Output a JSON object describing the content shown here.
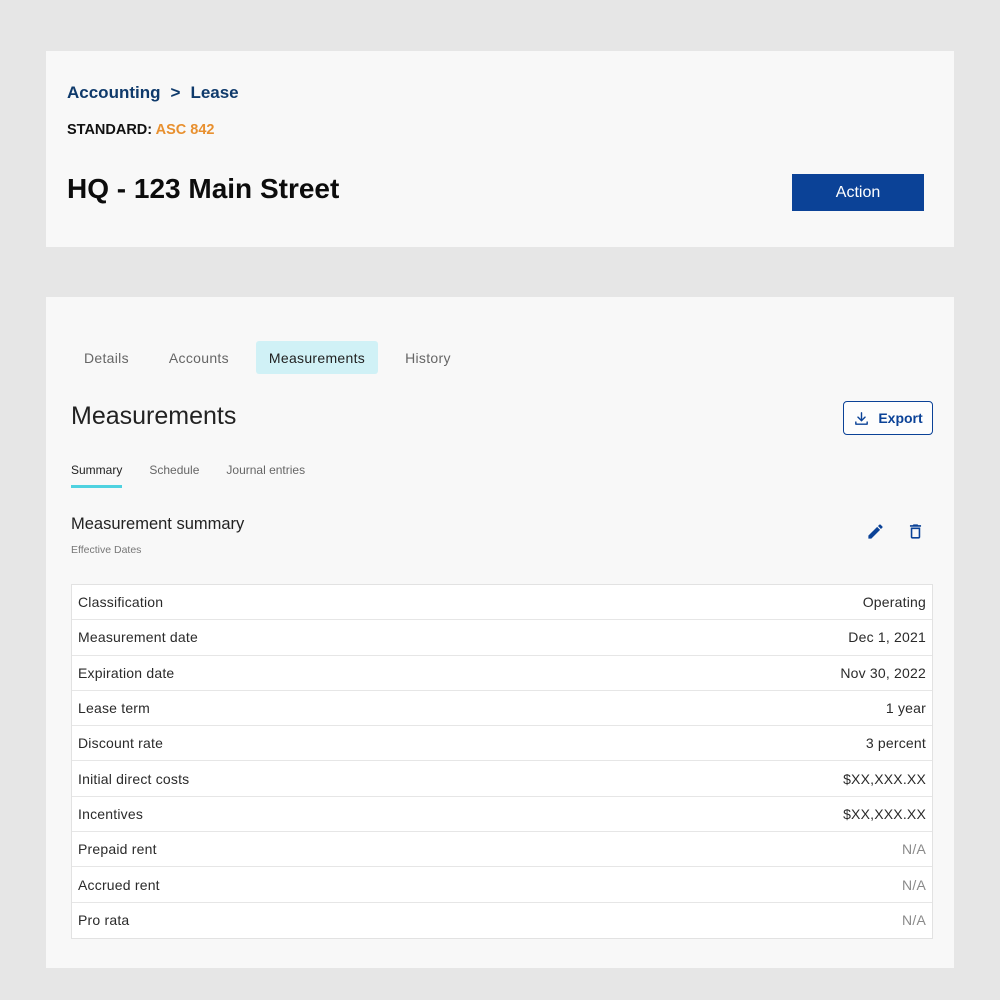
{
  "header": {
    "breadcrumb": {
      "parent": "Accounting",
      "separator": ">",
      "current": "Lease"
    },
    "standard_label": "STANDARD:",
    "standard_value": "ASC 842",
    "title": "HQ - 123 Main Street",
    "action_label": "Action"
  },
  "tabs": [
    {
      "label": "Details",
      "active": false
    },
    {
      "label": "Accounts",
      "active": false
    },
    {
      "label": "Measurements",
      "active": true
    },
    {
      "label": "History",
      "active": false
    }
  ],
  "main": {
    "title": "Measurements",
    "export_label": "Export",
    "subtabs": [
      {
        "label": "Summary",
        "active": true
      },
      {
        "label": "Schedule",
        "active": false
      },
      {
        "label": "Journal entries",
        "active": false
      }
    ],
    "summary": {
      "title": "Measurement summary",
      "subtitle": "Effective Dates",
      "rows": [
        {
          "label": "Classification",
          "value": "Operating"
        },
        {
          "label": "Measurement date",
          "value": "Dec 1, 2021"
        },
        {
          "label": "Expiration date",
          "value": "Nov 30, 2022"
        },
        {
          "label": "Lease term",
          "value": "1 year"
        },
        {
          "label": "Discount rate",
          "value": "3 percent"
        },
        {
          "label": "Initial direct costs",
          "value": "$XX,XXX.XX"
        },
        {
          "label": "Incentives",
          "value": "$XX,XXX.XX"
        },
        {
          "label": "Prepaid rent",
          "value": "N/A"
        },
        {
          "label": "Accrued rent",
          "value": "N/A"
        },
        {
          "label": "Pro rata",
          "value": "N/A"
        }
      ]
    }
  },
  "colors": {
    "brand_blue": "#0b4297",
    "breadcrumb_blue": "#0f3a6b",
    "standard_orange": "#e8902f",
    "active_tab_bg": "#d0f1f6",
    "subtab_underline": "#4fd2e0"
  },
  "icons": [
    "download-icon",
    "pencil-icon",
    "trash-icon"
  ]
}
